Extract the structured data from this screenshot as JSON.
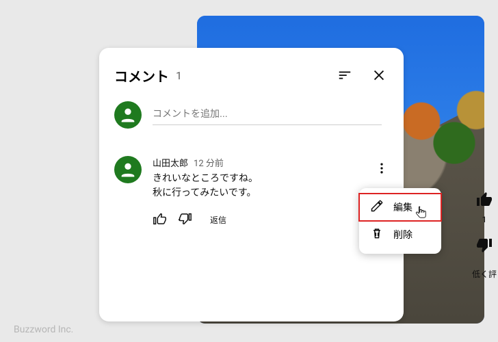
{
  "panel": {
    "title": "コメント",
    "count": "1",
    "input_placeholder": "コメントを追加...",
    "reply_label": "返信"
  },
  "comment": {
    "author": "山田太郎",
    "time": "12 分前",
    "text": "きれいなところですね。\n秋に行ってみたいです。"
  },
  "menu": {
    "edit": "編集",
    "delete": "削除"
  },
  "rail": {
    "like_count": "1",
    "more_text": "低く評"
  },
  "watermark": "Buzzword Inc."
}
